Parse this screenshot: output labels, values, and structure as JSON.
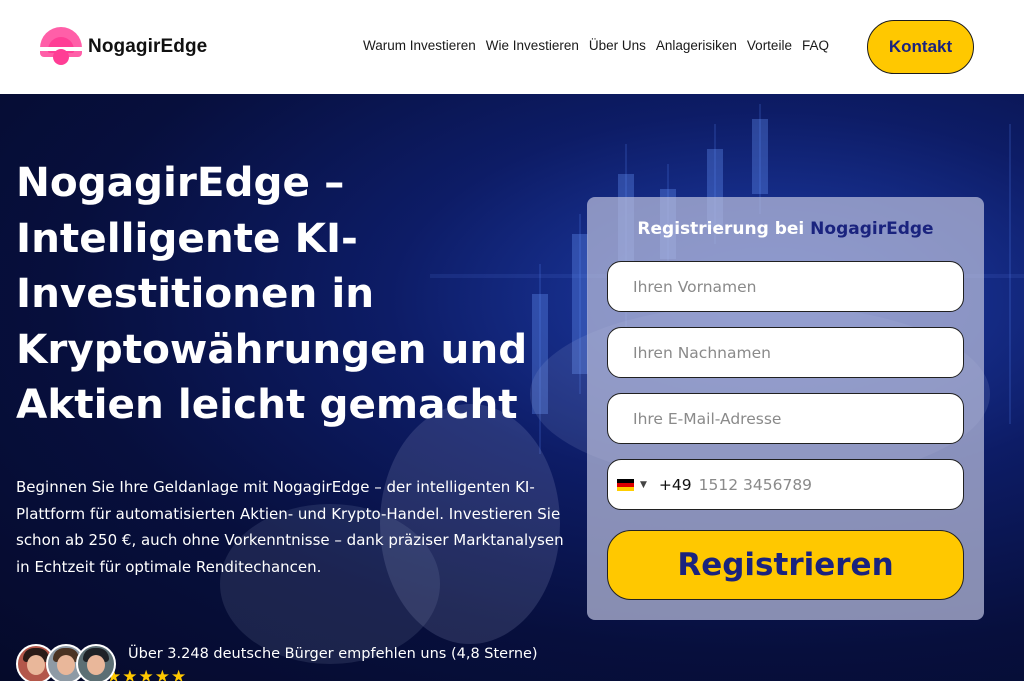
{
  "header": {
    "brand": "NogagirEdge",
    "nav": [
      "Warum Investieren",
      "Wie Investieren",
      "Über Uns",
      "Anlagerisiken",
      "Vorteile",
      "FAQ"
    ],
    "contact_label": "Kontakt"
  },
  "hero": {
    "headline": "NogagirEdge – Intelligente KI-Investitionen in Kryptowährungen und Aktien leicht gemacht",
    "subtext": "Beginnen Sie Ihre Geldanlage mit NogagirEdge – der intelligenten KI-Plattform für automatisierten Aktien- und Krypto-Handel. Investieren Sie schon ab 250 €, auch ohne Vorkenntnisse – dank präziser Marktanalysen in Echtzeit für optimale Renditechancen.",
    "social_proof": "Über 3.248 deutsche Bürger empfehlen uns (4,8 Sterne)",
    "stars": "★★★★★"
  },
  "form": {
    "title_prefix": "Registrierung bei",
    "title_brand": "NogagirEdge",
    "first_name_placeholder": "Ihren Vornamen",
    "last_name_placeholder": "Ihren Nachnamen",
    "email_placeholder": "Ihre E-Mail-Adresse",
    "dial_code": "+49",
    "phone_placeholder": "1512 3456789",
    "submit_label": "Registrieren"
  },
  "colors": {
    "accent_yellow": "#ffc800",
    "brand_navy": "#1a237e",
    "logo_pink": "#ff3e95",
    "hero_dark": "#070f3d"
  }
}
